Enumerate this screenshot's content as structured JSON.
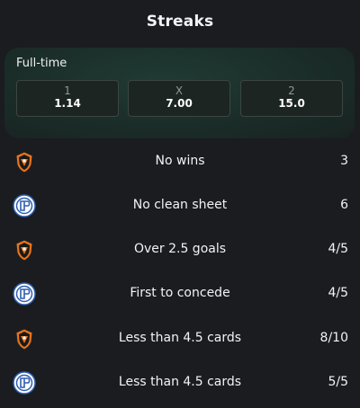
{
  "title": "Streaks",
  "odds": {
    "label": "Full-time",
    "options": [
      {
        "selection": "1",
        "value": "1.14"
      },
      {
        "selection": "X",
        "value": "7.00"
      },
      {
        "selection": "2",
        "value": "15.0"
      }
    ]
  },
  "streaks": [
    {
      "team": "shakhtar",
      "label": "No wins",
      "count": "3"
    },
    {
      "team": "opponent",
      "label": "No clean sheet",
      "count": "6"
    },
    {
      "team": "shakhtar",
      "label": "Over 2.5 goals",
      "count": "4/5"
    },
    {
      "team": "opponent",
      "label": "First to concede",
      "count": "4/5"
    },
    {
      "team": "shakhtar",
      "label": "Less than 4.5 cards",
      "count": "8/10"
    },
    {
      "team": "opponent",
      "label": "Less than 4.5 cards",
      "count": "5/5"
    }
  ],
  "colors": {
    "background": "#1a1c20",
    "card": "#1b2d29",
    "shakhtar_orange": "#e8741c",
    "opponent_blue": "#2f5fb0"
  },
  "icons": {
    "shakhtar": "shakhtar-crest-icon",
    "opponent": "blue-circle-crest-icon"
  }
}
